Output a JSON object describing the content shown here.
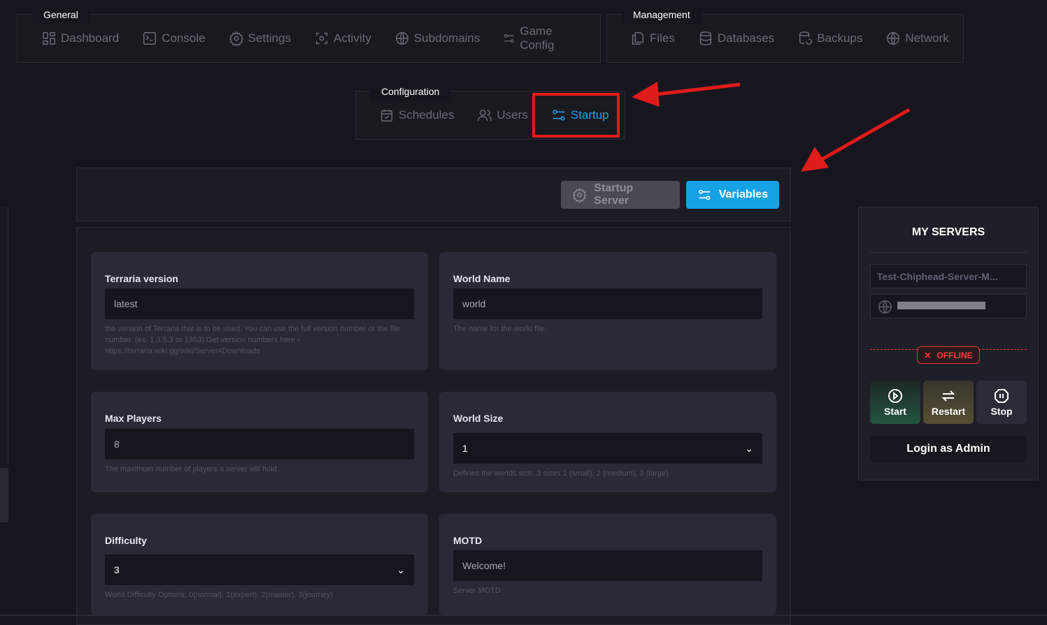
{
  "nav_groups": {
    "general": {
      "title": "General",
      "items": [
        "Dashboard",
        "Console",
        "Settings",
        "Activity",
        "Subdomains",
        "Game Config"
      ]
    },
    "management": {
      "title": "Management",
      "items": [
        "Files",
        "Databases",
        "Backups",
        "Network"
      ]
    },
    "configuration": {
      "title": "Configuration",
      "items": [
        "Schedules",
        "Users",
        "Startup"
      ],
      "active": "Startup"
    }
  },
  "toolbar": {
    "startup_server": "Startup Server",
    "variables": "Variables"
  },
  "variables": [
    {
      "label": "Terraria version",
      "value": "latest",
      "type": "text",
      "description": "the version of Terraria that is to be used. You can use the full version number or the file number. (ex. 1.3.5.3 or 1353) Get version numbers here - https://terraria.wiki.gg/wiki/Server#Downloads"
    },
    {
      "label": "World Name",
      "value": "world",
      "type": "text",
      "description": "The name for the world file."
    },
    {
      "label": "Max Players",
      "value": "8",
      "type": "text",
      "description": "The maximum number of players a server will hold."
    },
    {
      "label": "World Size",
      "value": "1",
      "type": "select",
      "description": "Defines the worlds size. 3 sizes 1 (small), 2 (medium), 3 (large)."
    },
    {
      "label": "Difficulty",
      "value": "3",
      "type": "select",
      "description": "World Difficulty Options: 0(normal), 1(expert), 2(master), 3(journey)"
    },
    {
      "label": "MOTD",
      "value": "Welcome!",
      "type": "text",
      "description": "Server MOTD"
    }
  ],
  "sidebar": {
    "title": "MY SERVERS",
    "server_name": "Test-Chiphead-Server-M...",
    "status": "OFFLINE",
    "start": "Start",
    "restart": "Restart",
    "stop": "Stop",
    "login_admin": "Login as Admin"
  },
  "colors": {
    "accent": "#1aa3e8",
    "annotation": "#e01b1b",
    "offline": "#ff3b3b"
  }
}
